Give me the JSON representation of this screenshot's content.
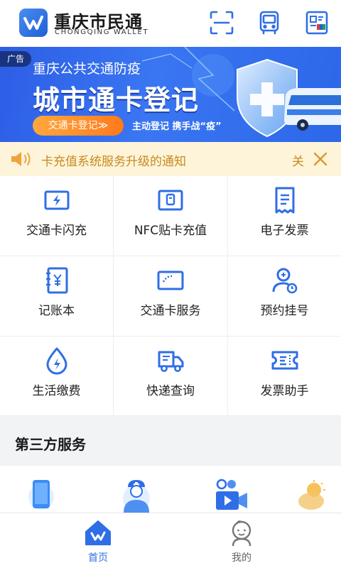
{
  "header": {
    "brand_cn": "重庆市民通",
    "brand_en": "CHONGQING WALLET",
    "icons": [
      "scan-icon",
      "bus-icon",
      "unionpay-card-icon"
    ]
  },
  "banner": {
    "ad_tag": "广告",
    "subtitle": "重庆公共交通防疫",
    "title": "城市通卡登记",
    "button": "交通卡登记≫",
    "note": "主动登记  携手战“疫”"
  },
  "notice": {
    "text": "卡充值系统服务升级的通知",
    "close_label": "关"
  },
  "services": [
    {
      "label": "交通卡闪充",
      "icon": "flash-charge-card-icon"
    },
    {
      "label": "NFC贴卡充值",
      "icon": "nfc-card-icon"
    },
    {
      "label": "电子发票",
      "icon": "e-invoice-icon"
    },
    {
      "label": "记账本",
      "icon": "ledger-book-icon"
    },
    {
      "label": "交通卡服务",
      "icon": "transit-card-service-icon"
    },
    {
      "label": "预约挂号",
      "icon": "doctor-appointment-icon"
    },
    {
      "label": "生活缴费",
      "icon": "utility-drop-icon"
    },
    {
      "label": "快递查询",
      "icon": "delivery-truck-icon"
    },
    {
      "label": "发票助手",
      "icon": "invoice-ticket-icon"
    }
  ],
  "third_party": {
    "title": "第三方服务",
    "icons": [
      "phone-icon",
      "nurse-icon",
      "video-camera-icon",
      "sun-cloud-icon"
    ]
  },
  "tabbar": {
    "home": "首页",
    "mine": "我的"
  },
  "colors": {
    "primary": "#2f6ee6",
    "notice_text": "#c88a1c",
    "notice_bg": "#fdf4da"
  }
}
